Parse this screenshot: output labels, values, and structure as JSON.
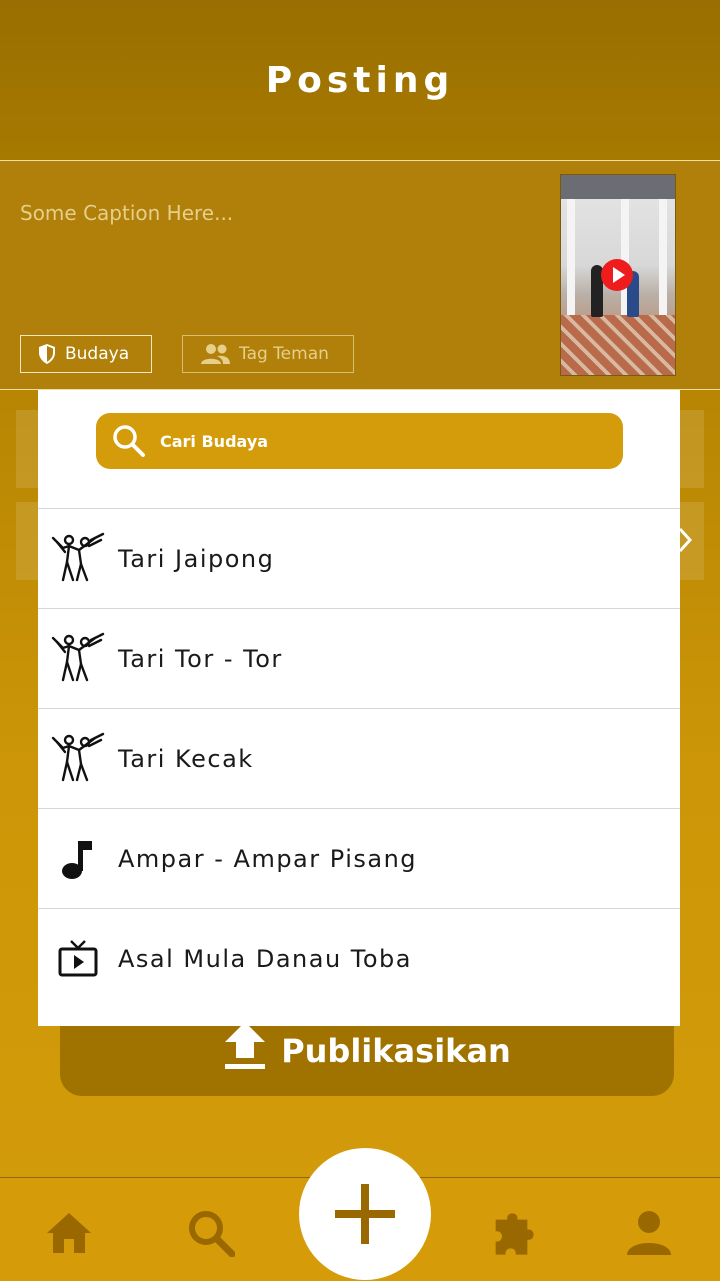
{
  "header": {
    "title": "Posting"
  },
  "compose": {
    "caption_placeholder": "Some Caption Here...",
    "chips": {
      "budaya": "Budaya",
      "tag": "Tag Teman"
    },
    "thumbnail": {
      "icon": "play-icon"
    }
  },
  "dropdown": {
    "search_placeholder": "Cari Budaya",
    "items": [
      {
        "label": "Tari Jaipong",
        "icon": "dance-icon"
      },
      {
        "label": "Tari Tor - Tor",
        "icon": "dance-icon"
      },
      {
        "label": "Tari Kecak",
        "icon": "dance-icon"
      },
      {
        "label": "Ampar - Ampar Pisang",
        "icon": "music-note-icon"
      },
      {
        "label": "Asal Mula Danau Toba",
        "icon": "tv-icon"
      }
    ]
  },
  "publish": {
    "label": "Publikasikan",
    "icon": "upload-icon"
  },
  "navbar": {
    "items": [
      "home-icon",
      "search-icon",
      "add-icon",
      "puzzle-icon",
      "person-icon"
    ]
  },
  "colors": {
    "primary": "#a67a00",
    "accent": "#d49c0a",
    "publish": "#a07300",
    "nav_icon": "#9a6800"
  }
}
